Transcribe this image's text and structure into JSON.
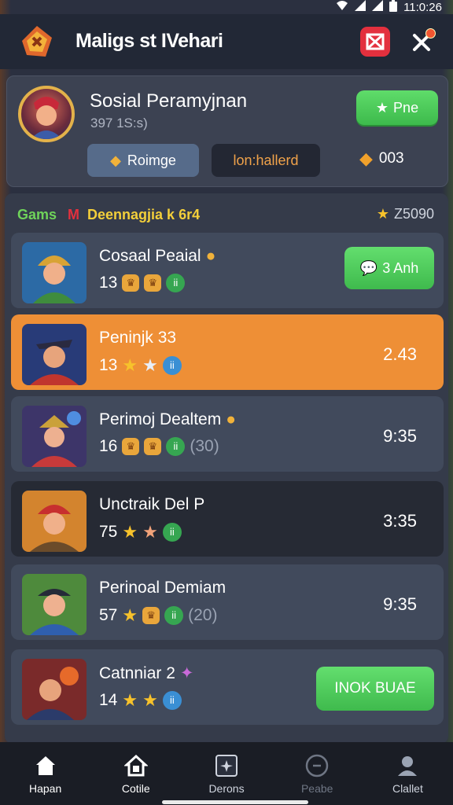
{
  "status_bar": {
    "time": "11:0:26"
  },
  "app_bar": {
    "title": "Maligs st IVehari"
  },
  "profile": {
    "name": "Sosial Peramyjnan",
    "sub": "397 1S:s)",
    "play_label": "Pne",
    "chip_a": "Roimge",
    "chip_b": "lon:hallerd",
    "coins": "003"
  },
  "list_header": {
    "games": "Gams",
    "m": "M",
    "subtitle": "Deennagjia k 6r4",
    "score": "Z5090"
  },
  "rows": [
    {
      "title": "Cosaal Peaial",
      "num": "13",
      "action": "3 Anh",
      "time": "",
      "extra": ""
    },
    {
      "title": "Peninjk 33",
      "num": "13",
      "action": "",
      "time": "2.43",
      "extra": ""
    },
    {
      "title": "Perimoj Dealtem",
      "num": "16",
      "action": "",
      "time": "9:35",
      "extra": "(30)"
    },
    {
      "title": "Unctraik Del P",
      "num": "75",
      "action": "",
      "time": "3:35",
      "extra": ""
    },
    {
      "title": "Perinoal Demiam",
      "num": "57",
      "action": "",
      "time": "9:35",
      "extra": "(20)"
    },
    {
      "title": "Catnniar 2",
      "num": "14",
      "action": "INOK BUAE",
      "time": "",
      "extra": ""
    }
  ],
  "bottom_nav": [
    {
      "label": "Hapan"
    },
    {
      "label": "Cotile"
    },
    {
      "label": "Derons"
    },
    {
      "label": "Peabe"
    },
    {
      "label": "Clallet"
    }
  ],
  "colors": {
    "accent_green": "#4cc85a",
    "highlight_orange": "#ee8f36",
    "danger_red": "#e3303e"
  },
  "icons": [
    "wifi-icon",
    "signal-icon",
    "battery-icon",
    "app-logo-icon",
    "red-shield-icon",
    "tools-icon",
    "star-icon",
    "coin-icon",
    "chat-icon",
    "home-icon",
    "cottage-icon",
    "card-icon",
    "clock-icon",
    "profile-icon"
  ]
}
